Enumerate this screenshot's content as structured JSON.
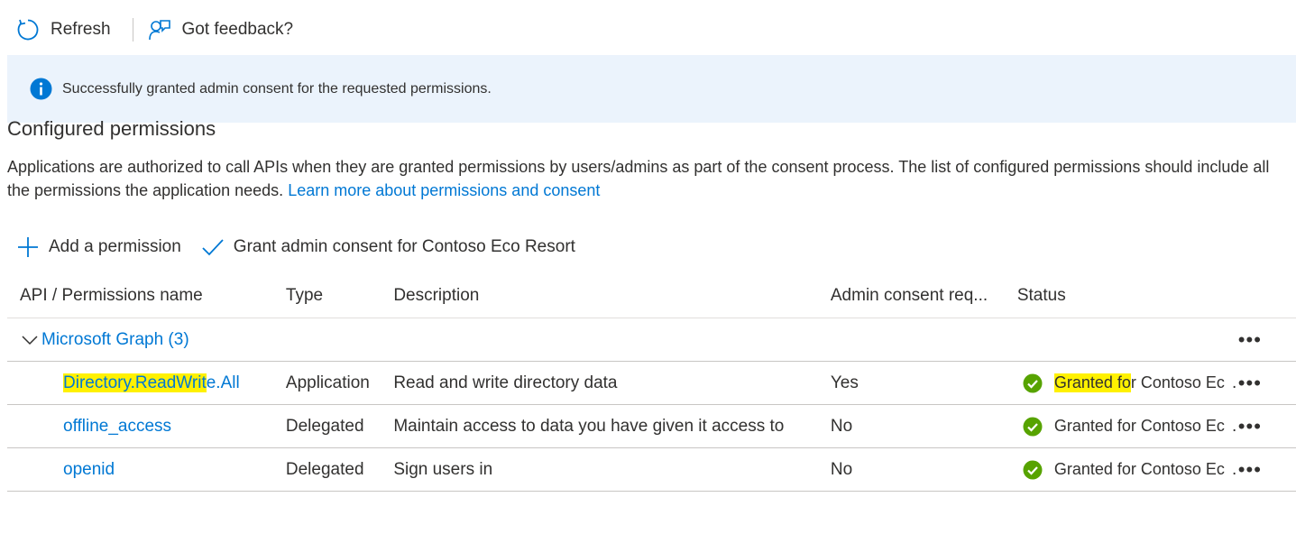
{
  "toolbar": {
    "refresh_label": "Refresh",
    "feedback_label": "Got feedback?"
  },
  "banner": {
    "message": "Successfully granted admin consent for the requested permissions."
  },
  "section": {
    "title": "Configured permissions",
    "description": "Applications are authorized to call APIs when they are granted permissions by users/admins as part of the consent process. The list of configured permissions should include all the permissions the application needs. ",
    "learn_more": "Learn more about permissions and consent"
  },
  "actions": {
    "add_permission": "Add a permission",
    "grant_consent": "Grant admin consent for Contoso Eco Resort"
  },
  "table": {
    "headers": {
      "name": "API / Permissions name",
      "type": "Type",
      "description": "Description",
      "admin": "Admin consent req...",
      "status": "Status"
    },
    "group": {
      "label": "Microsoft Graph (3)"
    },
    "rows": [
      {
        "name_highlight": "Directory.ReadWrit",
        "name_rest": "e.All",
        "type": "Application",
        "description": "Read and write directory data",
        "admin": "Yes",
        "status_highlight": "Granted fo",
        "status_rest": "r Contoso Ec"
      },
      {
        "name": "offline_access",
        "type": "Delegated",
        "description": "Maintain access to data you have given it access to",
        "admin": "No",
        "status": "Granted for Contoso Ec"
      },
      {
        "name": "openid",
        "type": "Delegated",
        "description": "Sign users in",
        "admin": "No",
        "status": "Granted for Contoso Ec"
      }
    ],
    "ellipsis": "...",
    "more_label": "•••"
  },
  "colors": {
    "accent": "#0078d4",
    "success": "#57a300",
    "banner_bg": "#ebf3fc",
    "highlight": "#fff100"
  }
}
